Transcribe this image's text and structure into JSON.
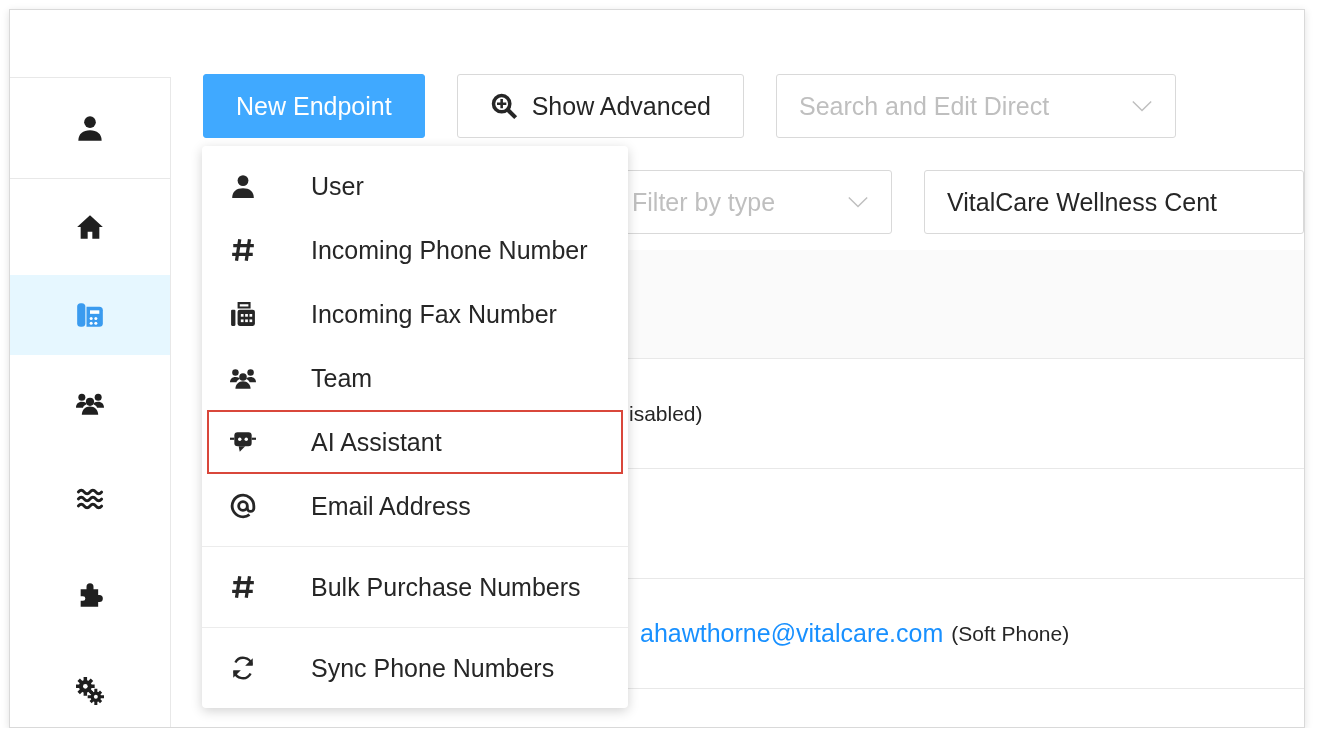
{
  "sidebar": {
    "items": [
      {
        "kind": "user",
        "selected": false
      },
      {
        "kind": "home",
        "selected": false
      },
      {
        "kind": "phone",
        "selected": true
      },
      {
        "kind": "team",
        "selected": false
      },
      {
        "kind": "waves",
        "selected": false
      },
      {
        "kind": "puzzle",
        "selected": false
      },
      {
        "kind": "gears",
        "selected": false
      }
    ]
  },
  "toolbar": {
    "new_button": "New Endpoint",
    "advanced_button": "Show Advanced",
    "search": {
      "placeholder": "Search and Edit Direct"
    }
  },
  "filters": {
    "type_filter": {
      "placeholder": "Filter by type"
    },
    "organization": {
      "value": "VitalCare Wellness Cent"
    }
  },
  "table": {
    "rows": [
      {
        "kind": "text",
        "text": "isabled)"
      },
      {
        "kind": "empty"
      },
      {
        "kind": "contact",
        "link": "ahawthorne@vitalcare.com",
        "note": "(Soft Phone)"
      }
    ]
  },
  "menu": {
    "sections": [
      {
        "items": [
          {
            "kind": "user",
            "label": "User",
            "highlighted": false
          },
          {
            "kind": "hash",
            "label": "Incoming Phone Number",
            "highlighted": false
          },
          {
            "kind": "fax",
            "label": "Incoming Fax Number",
            "highlighted": false
          },
          {
            "kind": "team",
            "label": "Team",
            "highlighted": false
          },
          {
            "kind": "robot",
            "label": "AI Assistant",
            "highlighted": true
          },
          {
            "kind": "at",
            "label": "Email Address",
            "highlighted": false
          }
        ]
      },
      {
        "items": [
          {
            "kind": "hash",
            "label": "Bulk Purchase Numbers",
            "highlighted": false
          }
        ]
      },
      {
        "items": [
          {
            "kind": "sync",
            "label": "Sync Phone Numbers",
            "highlighted": false
          }
        ]
      }
    ]
  }
}
